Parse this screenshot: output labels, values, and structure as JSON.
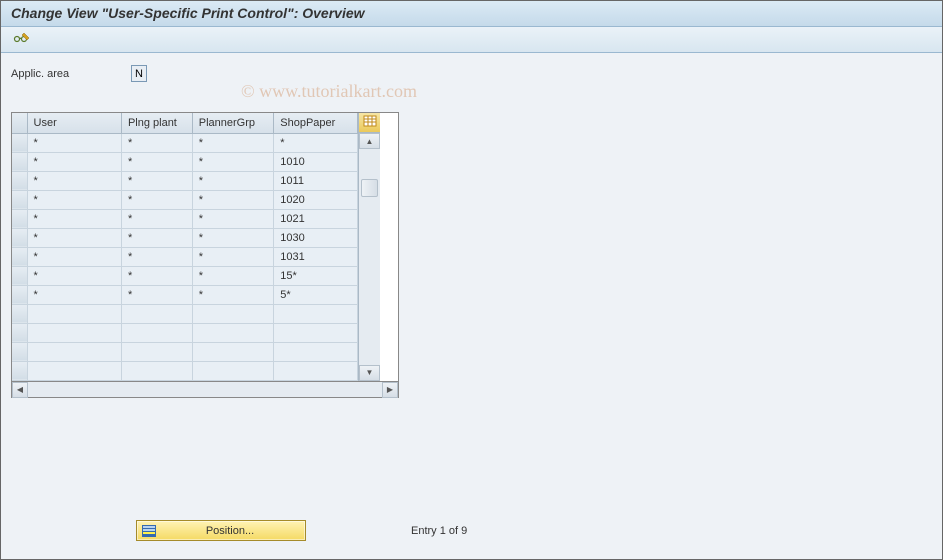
{
  "title": "Change View \"User-Specific Print Control\": Overview",
  "watermark": "© www.tutorialkart.com",
  "fields": {
    "applic_area": {
      "label": "Applic. area",
      "value": "N"
    }
  },
  "table": {
    "columns": [
      "User",
      "Plng plant",
      "PlannerGrp",
      "ShopPaper"
    ],
    "rows": [
      {
        "user": "*",
        "plng_plant": "*",
        "planner_grp": "*",
        "shop_paper": "*"
      },
      {
        "user": "*",
        "plng_plant": "*",
        "planner_grp": "*",
        "shop_paper": "1010"
      },
      {
        "user": "*",
        "plng_plant": "*",
        "planner_grp": "*",
        "shop_paper": "1011"
      },
      {
        "user": "*",
        "plng_plant": "*",
        "planner_grp": "*",
        "shop_paper": "1020"
      },
      {
        "user": "*",
        "plng_plant": "*",
        "planner_grp": "*",
        "shop_paper": "1021"
      },
      {
        "user": "*",
        "plng_plant": "*",
        "planner_grp": "*",
        "shop_paper": "1030"
      },
      {
        "user": "*",
        "plng_plant": "*",
        "planner_grp": "*",
        "shop_paper": "1031"
      },
      {
        "user": "*",
        "plng_plant": "*",
        "planner_grp": "*",
        "shop_paper": "15*"
      },
      {
        "user": "*",
        "plng_plant": "*",
        "planner_grp": "*",
        "shop_paper": "5*"
      }
    ],
    "empty_rows": 4
  },
  "footer": {
    "position_label": "Position...",
    "entry_text": "Entry 1 of 9"
  }
}
